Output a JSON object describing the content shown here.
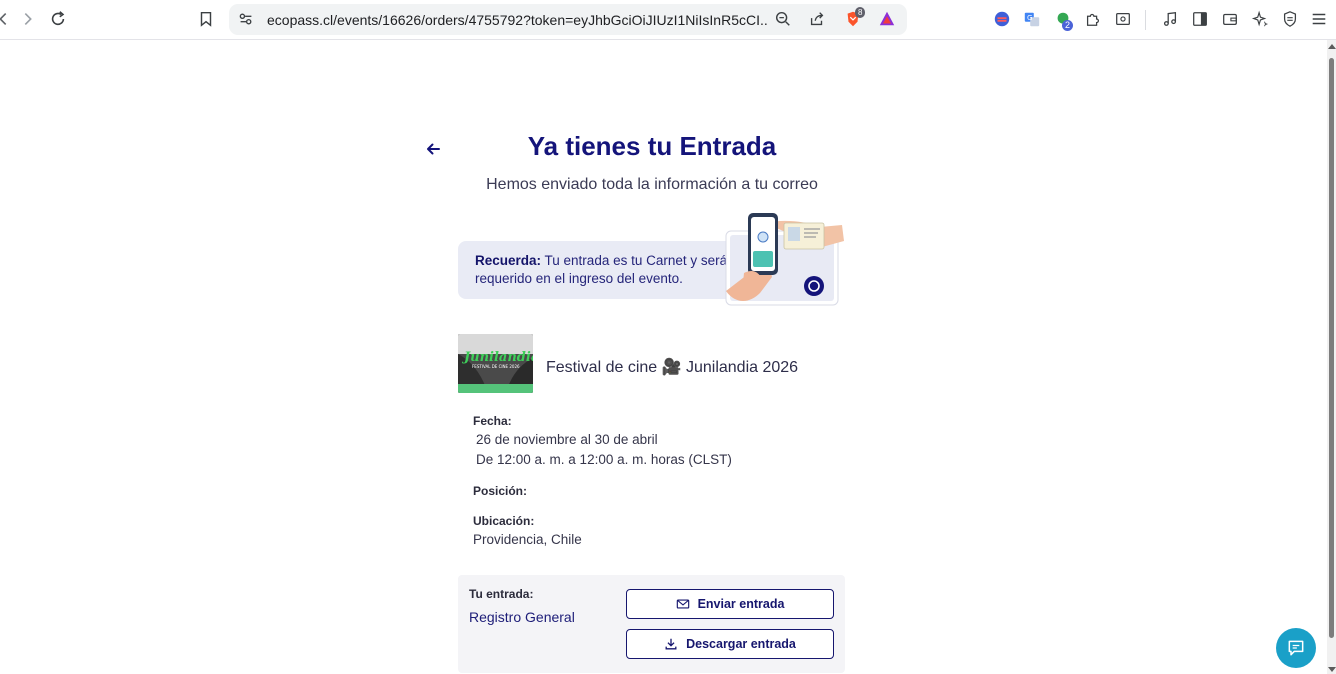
{
  "browser": {
    "url": "ecopass.cl/events/16626/orders/4755792?token=eyJhbGciOiJIUzI1NiIsInR5cCI...",
    "brave_badge": "8",
    "extension_badge": "2"
  },
  "page": {
    "title": "Ya tienes tu Entrada",
    "subtitle": "Hemos enviado toda la información a tu correo",
    "reminder": {
      "bold": "Recuerda:",
      "text": " Tu entrada es tu Carnet y será requerido en el ingreso del evento."
    },
    "event": {
      "name": "Festival de cine 🎥 Junilandia 2026",
      "thumb_title": "Junilandia",
      "thumb_subtitle": "FESTIVAL DE CINE 2026"
    },
    "fields": {
      "fecha_label": "Fecha:",
      "fecha_dates": "26 de noviembre al 30 de abril",
      "fecha_hours": "De 12:00 a. m. a 12:00 a. m. horas (CLST)",
      "posicion_label": "Posición:",
      "ubicacion_label": "Ubicación:",
      "ubicacion_value": "Providencia, Chile"
    },
    "ticket": {
      "label": "Tu entrada:",
      "value": "Registro General",
      "send_label": "Enviar entrada",
      "download_label": "Descargar entrada"
    }
  },
  "colors": {
    "accent": "#14147a",
    "chat": "#1aa0c8"
  }
}
